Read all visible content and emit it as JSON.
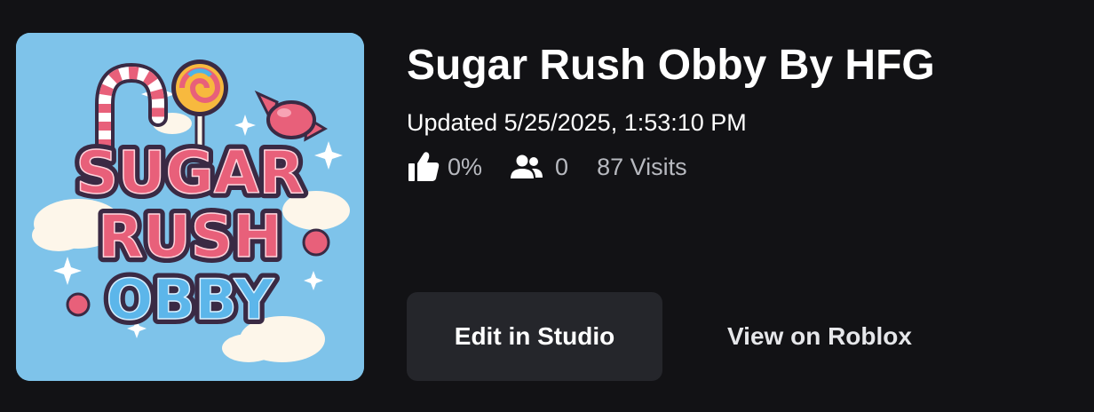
{
  "game": {
    "thumbnail_text": [
      "SUGAR",
      "RUSH",
      "OBBY"
    ],
    "title": "Sugar Rush Obby By HFG",
    "updated": "Updated 5/25/2025, 1:53:10 PM",
    "stats": {
      "like_icon": "thumbs-up-icon",
      "like_ratio": "0%",
      "players_icon": "users-icon",
      "players": "0",
      "visits": "87 Visits"
    }
  },
  "actions": {
    "edit_label": "Edit in Studio",
    "view_label": "View on Roblox"
  },
  "colors": {
    "background": "#121215",
    "button": "#25262b",
    "thumbnail_bg": "#7ec3ea",
    "candy_pink": "#e8607a",
    "candy_blue": "#5cb6ea"
  }
}
